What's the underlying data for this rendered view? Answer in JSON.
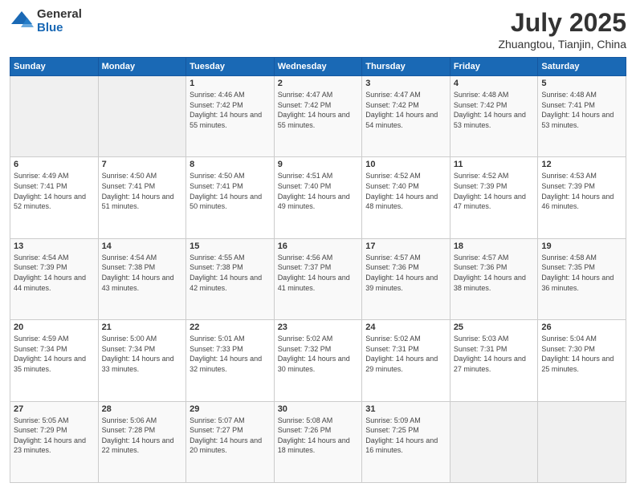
{
  "logo": {
    "general": "General",
    "blue": "Blue"
  },
  "header": {
    "title": "July 2025",
    "subtitle": "Zhuangtou, Tianjin, China"
  },
  "weekdays": [
    "Sunday",
    "Monday",
    "Tuesday",
    "Wednesday",
    "Thursday",
    "Friday",
    "Saturday"
  ],
  "weeks": [
    [
      {
        "day": "",
        "sunrise": "",
        "sunset": "",
        "daylight": ""
      },
      {
        "day": "",
        "sunrise": "",
        "sunset": "",
        "daylight": ""
      },
      {
        "day": "1",
        "sunrise": "Sunrise: 4:46 AM",
        "sunset": "Sunset: 7:42 PM",
        "daylight": "Daylight: 14 hours and 55 minutes."
      },
      {
        "day": "2",
        "sunrise": "Sunrise: 4:47 AM",
        "sunset": "Sunset: 7:42 PM",
        "daylight": "Daylight: 14 hours and 55 minutes."
      },
      {
        "day": "3",
        "sunrise": "Sunrise: 4:47 AM",
        "sunset": "Sunset: 7:42 PM",
        "daylight": "Daylight: 14 hours and 54 minutes."
      },
      {
        "day": "4",
        "sunrise": "Sunrise: 4:48 AM",
        "sunset": "Sunset: 7:42 PM",
        "daylight": "Daylight: 14 hours and 53 minutes."
      },
      {
        "day": "5",
        "sunrise": "Sunrise: 4:48 AM",
        "sunset": "Sunset: 7:41 PM",
        "daylight": "Daylight: 14 hours and 53 minutes."
      }
    ],
    [
      {
        "day": "6",
        "sunrise": "Sunrise: 4:49 AM",
        "sunset": "Sunset: 7:41 PM",
        "daylight": "Daylight: 14 hours and 52 minutes."
      },
      {
        "day": "7",
        "sunrise": "Sunrise: 4:50 AM",
        "sunset": "Sunset: 7:41 PM",
        "daylight": "Daylight: 14 hours and 51 minutes."
      },
      {
        "day": "8",
        "sunrise": "Sunrise: 4:50 AM",
        "sunset": "Sunset: 7:41 PM",
        "daylight": "Daylight: 14 hours and 50 minutes."
      },
      {
        "day": "9",
        "sunrise": "Sunrise: 4:51 AM",
        "sunset": "Sunset: 7:40 PM",
        "daylight": "Daylight: 14 hours and 49 minutes."
      },
      {
        "day": "10",
        "sunrise": "Sunrise: 4:52 AM",
        "sunset": "Sunset: 7:40 PM",
        "daylight": "Daylight: 14 hours and 48 minutes."
      },
      {
        "day": "11",
        "sunrise": "Sunrise: 4:52 AM",
        "sunset": "Sunset: 7:39 PM",
        "daylight": "Daylight: 14 hours and 47 minutes."
      },
      {
        "day": "12",
        "sunrise": "Sunrise: 4:53 AM",
        "sunset": "Sunset: 7:39 PM",
        "daylight": "Daylight: 14 hours and 46 minutes."
      }
    ],
    [
      {
        "day": "13",
        "sunrise": "Sunrise: 4:54 AM",
        "sunset": "Sunset: 7:39 PM",
        "daylight": "Daylight: 14 hours and 44 minutes."
      },
      {
        "day": "14",
        "sunrise": "Sunrise: 4:54 AM",
        "sunset": "Sunset: 7:38 PM",
        "daylight": "Daylight: 14 hours and 43 minutes."
      },
      {
        "day": "15",
        "sunrise": "Sunrise: 4:55 AM",
        "sunset": "Sunset: 7:38 PM",
        "daylight": "Daylight: 14 hours and 42 minutes."
      },
      {
        "day": "16",
        "sunrise": "Sunrise: 4:56 AM",
        "sunset": "Sunset: 7:37 PM",
        "daylight": "Daylight: 14 hours and 41 minutes."
      },
      {
        "day": "17",
        "sunrise": "Sunrise: 4:57 AM",
        "sunset": "Sunset: 7:36 PM",
        "daylight": "Daylight: 14 hours and 39 minutes."
      },
      {
        "day": "18",
        "sunrise": "Sunrise: 4:57 AM",
        "sunset": "Sunset: 7:36 PM",
        "daylight": "Daylight: 14 hours and 38 minutes."
      },
      {
        "day": "19",
        "sunrise": "Sunrise: 4:58 AM",
        "sunset": "Sunset: 7:35 PM",
        "daylight": "Daylight: 14 hours and 36 minutes."
      }
    ],
    [
      {
        "day": "20",
        "sunrise": "Sunrise: 4:59 AM",
        "sunset": "Sunset: 7:34 PM",
        "daylight": "Daylight: 14 hours and 35 minutes."
      },
      {
        "day": "21",
        "sunrise": "Sunrise: 5:00 AM",
        "sunset": "Sunset: 7:34 PM",
        "daylight": "Daylight: 14 hours and 33 minutes."
      },
      {
        "day": "22",
        "sunrise": "Sunrise: 5:01 AM",
        "sunset": "Sunset: 7:33 PM",
        "daylight": "Daylight: 14 hours and 32 minutes."
      },
      {
        "day": "23",
        "sunrise": "Sunrise: 5:02 AM",
        "sunset": "Sunset: 7:32 PM",
        "daylight": "Daylight: 14 hours and 30 minutes."
      },
      {
        "day": "24",
        "sunrise": "Sunrise: 5:02 AM",
        "sunset": "Sunset: 7:31 PM",
        "daylight": "Daylight: 14 hours and 29 minutes."
      },
      {
        "day": "25",
        "sunrise": "Sunrise: 5:03 AM",
        "sunset": "Sunset: 7:31 PM",
        "daylight": "Daylight: 14 hours and 27 minutes."
      },
      {
        "day": "26",
        "sunrise": "Sunrise: 5:04 AM",
        "sunset": "Sunset: 7:30 PM",
        "daylight": "Daylight: 14 hours and 25 minutes."
      }
    ],
    [
      {
        "day": "27",
        "sunrise": "Sunrise: 5:05 AM",
        "sunset": "Sunset: 7:29 PM",
        "daylight": "Daylight: 14 hours and 23 minutes."
      },
      {
        "day": "28",
        "sunrise": "Sunrise: 5:06 AM",
        "sunset": "Sunset: 7:28 PM",
        "daylight": "Daylight: 14 hours and 22 minutes."
      },
      {
        "day": "29",
        "sunrise": "Sunrise: 5:07 AM",
        "sunset": "Sunset: 7:27 PM",
        "daylight": "Daylight: 14 hours and 20 minutes."
      },
      {
        "day": "30",
        "sunrise": "Sunrise: 5:08 AM",
        "sunset": "Sunset: 7:26 PM",
        "daylight": "Daylight: 14 hours and 18 minutes."
      },
      {
        "day": "31",
        "sunrise": "Sunrise: 5:09 AM",
        "sunset": "Sunset: 7:25 PM",
        "daylight": "Daylight: 14 hours and 16 minutes."
      },
      {
        "day": "",
        "sunrise": "",
        "sunset": "",
        "daylight": ""
      },
      {
        "day": "",
        "sunrise": "",
        "sunset": "",
        "daylight": ""
      }
    ]
  ]
}
